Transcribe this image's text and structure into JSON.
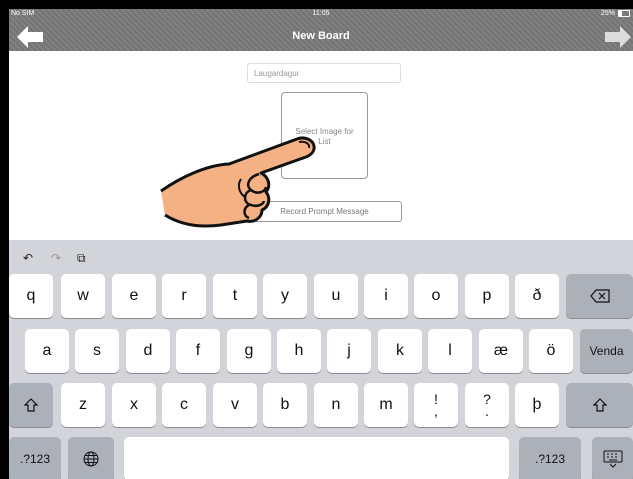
{
  "status": {
    "carrier": "No SIM",
    "time": "11:05",
    "battery": "25%"
  },
  "nav": {
    "title": "New Board",
    "back_icon": "arrow-left-icon",
    "forward_icon": "arrow-right-icon"
  },
  "form": {
    "list_name_value": "Laugardagur",
    "image_prompt_line1": "Select Image for",
    "image_prompt_line2": "List",
    "record_prompt": "Record Prompt Message"
  },
  "keyboard": {
    "row1": [
      "q",
      "w",
      "e",
      "r",
      "t",
      "y",
      "u",
      "i",
      "o",
      "p",
      "ð"
    ],
    "row2": [
      "a",
      "s",
      "d",
      "f",
      "g",
      "h",
      "j",
      "k",
      "l",
      "æ",
      "ö"
    ],
    "row3": [
      "z",
      "x",
      "c",
      "v",
      "b",
      "n",
      "m"
    ],
    "punct1_top": "!",
    "punct1_bottom": ",",
    "punct2_top": "?",
    "punct2_bottom": ".",
    "thorn": "þ",
    "return_label": "Venda",
    "numbers_label": ".?123"
  },
  "colors": {
    "navbar": "#7a7a7a",
    "keyboard_bg": "#d2d4d9",
    "key_light": "#ffffff",
    "key_dark": "#acb0b9",
    "hand_fill": "#f4b183"
  }
}
